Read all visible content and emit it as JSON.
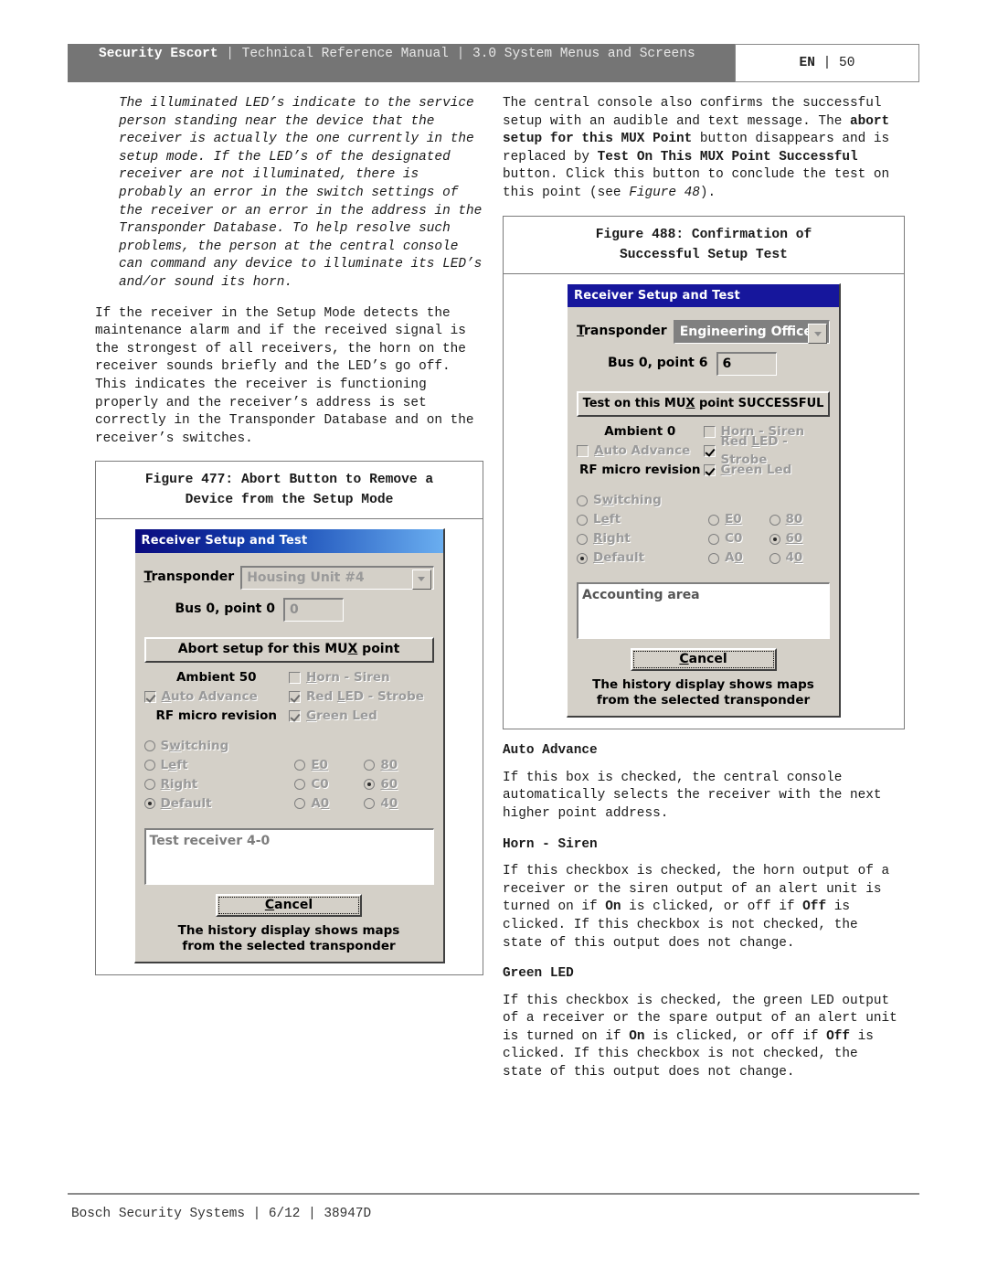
{
  "header": {
    "brand": "Security Escort",
    "sep": "|",
    "manual": "Technical Reference Manual",
    "section": "3.0  System Menus and Screens",
    "lang": "EN",
    "page": "50"
  },
  "left_column": {
    "note_italic": "The illuminated LED’s indicate to the service person standing near the device that the receiver is actually the one currently in the setup mode. If the LED’s of the designated receiver are not illuminated, there is probably an error in the switch settings of the receiver or an error in the address in the Transponder Database. To help resolve such problems, the person at the central console can command any device to illuminate its LED’s and/or sound its horn.",
    "para_setup_mode": "If the receiver in the Setup Mode detects the maintenance alarm and if the received signal is the strongest of all receivers, the horn on the receiver sounds briefly and the LED’s go off. This indicates the receiver is functioning properly and the receiver’s address is set correctly in the Transponder Database and on the receiver’s switches."
  },
  "right_column": {
    "para_console_confirm_1": "The central console also confirms the successful setup with an audible and text message. The ",
    "para_console_confirm_b1": "abort setup for this MUX Point",
    "para_console_confirm_2": " button disappears and is replaced by ",
    "para_console_confirm_b2": "Test On This MUX Point Successful",
    "para_console_confirm_3": " button. Click this button to conclude the test on this point (see ",
    "para_console_confirm_i": "Figure 48",
    "para_console_confirm_4": ").",
    "sections": [
      {
        "heading": "Auto Advance",
        "body": "If this box is checked, the central console automatically selects the receiver with the next higher point address."
      },
      {
        "heading": "Horn - Siren",
        "body_1": "If this checkbox is checked, the horn output of a receiver or the siren output of an alert unit is turned on if ",
        "body_b1": "On",
        "body_2": " is clicked, or off if ",
        "body_b2": "Off",
        "body_3": " is clicked. If this checkbox is not checked, the state of this output does not change."
      },
      {
        "heading": "Green LED",
        "body_1": "If this checkbox is checked, the green LED output of a receiver or the spare output of an alert unit is turned on if ",
        "body_b1": "On",
        "body_2": " is clicked, or off if ",
        "body_b2": "Off",
        "body_3": " is clicked. If this checkbox is not checked, the state of this output does not change."
      }
    ]
  },
  "figure_477": {
    "caption_line1": "Figure 477: Abort Button to Remove a",
    "caption_line2": "Device from the Setup Mode",
    "dialog": {
      "titlebar": "Receiver Setup and Test",
      "transponder_label": "Transponder",
      "transponder_value": "Housing Unit #4",
      "bus_label": "Bus 0, point 0",
      "bus_value": "0",
      "action_button": "Abort setup for this MUX point",
      "ambient_label": "Ambient 50",
      "rf_label": "RF micro revision",
      "checkboxes": [
        {
          "label": "Auto Advance",
          "checked": true,
          "column": "left"
        },
        {
          "label": "Horn - Siren",
          "checked": false,
          "column": "right"
        },
        {
          "label": "Red LED - Strobe",
          "checked": true,
          "column": "right"
        },
        {
          "label": "Green Led",
          "checked": true,
          "column": "right"
        }
      ],
      "radios_mode": [
        {
          "label": "Switching",
          "selected": false
        },
        {
          "label": "Left",
          "selected": false
        },
        {
          "label": "Right",
          "selected": false
        },
        {
          "label": "Default",
          "selected": true
        }
      ],
      "radios_addr_col1": [
        {
          "label": "E0",
          "selected": false
        },
        {
          "label": "C0",
          "selected": false
        },
        {
          "label": "A0",
          "selected": false
        }
      ],
      "radios_addr_col2": [
        {
          "label": "80",
          "selected": false
        },
        {
          "label": "60",
          "selected": true
        },
        {
          "label": "40",
          "selected": false
        }
      ],
      "memo_text": "Test receiver 4-0",
      "cancel_label": "Cancel",
      "footer_line1": "The history display shows maps",
      "footer_line2": "from the selected transponder"
    }
  },
  "figure_488": {
    "caption_line1": "Figure 488: Confirmation of",
    "caption_line2": "Successful Setup Test",
    "dialog": {
      "titlebar": "Receiver Setup and Test",
      "transponder_label": "Transponder",
      "transponder_value": "Engineering Office",
      "bus_label": "Bus 0, point 6",
      "bus_value": "6",
      "action_button": "Test on this MUX point SUCCESSFUL",
      "ambient_label": "Ambient 0",
      "rf_label": "RF micro revision",
      "checkboxes": [
        {
          "label": "Auto Advance",
          "checked": false,
          "column": "left"
        },
        {
          "label": "Horn - Siren",
          "checked": false,
          "column": "right"
        },
        {
          "label": "Red LED - Strobe",
          "checked": true,
          "column": "right"
        },
        {
          "label": "Green Led",
          "checked": true,
          "column": "right"
        }
      ],
      "radios_mode": [
        {
          "label": "Switching",
          "selected": false
        },
        {
          "label": "Left",
          "selected": false
        },
        {
          "label": "Right",
          "selected": false
        },
        {
          "label": "Default",
          "selected": true
        }
      ],
      "radios_addr_col1": [
        {
          "label": "E0",
          "selected": false
        },
        {
          "label": "C0",
          "selected": false
        },
        {
          "label": "A0",
          "selected": false
        }
      ],
      "radios_addr_col2": [
        {
          "label": "80",
          "selected": false
        },
        {
          "label": "60",
          "selected": true
        },
        {
          "label": "40",
          "selected": false
        }
      ],
      "memo_text": "Accounting area",
      "cancel_label": "Cancel",
      "footer_line1": "The history display shows maps",
      "footer_line2": "from the selected transponder"
    }
  },
  "footer": {
    "text": "Bosch Security Systems | 6/12 | 38947D"
  },
  "colors": {
    "header_bar": "#757575",
    "titlebar_blue_dark": "#0a0a7e",
    "titlebar_blue_solid": "#16169c",
    "dialog_face": "#d4d0c8"
  }
}
